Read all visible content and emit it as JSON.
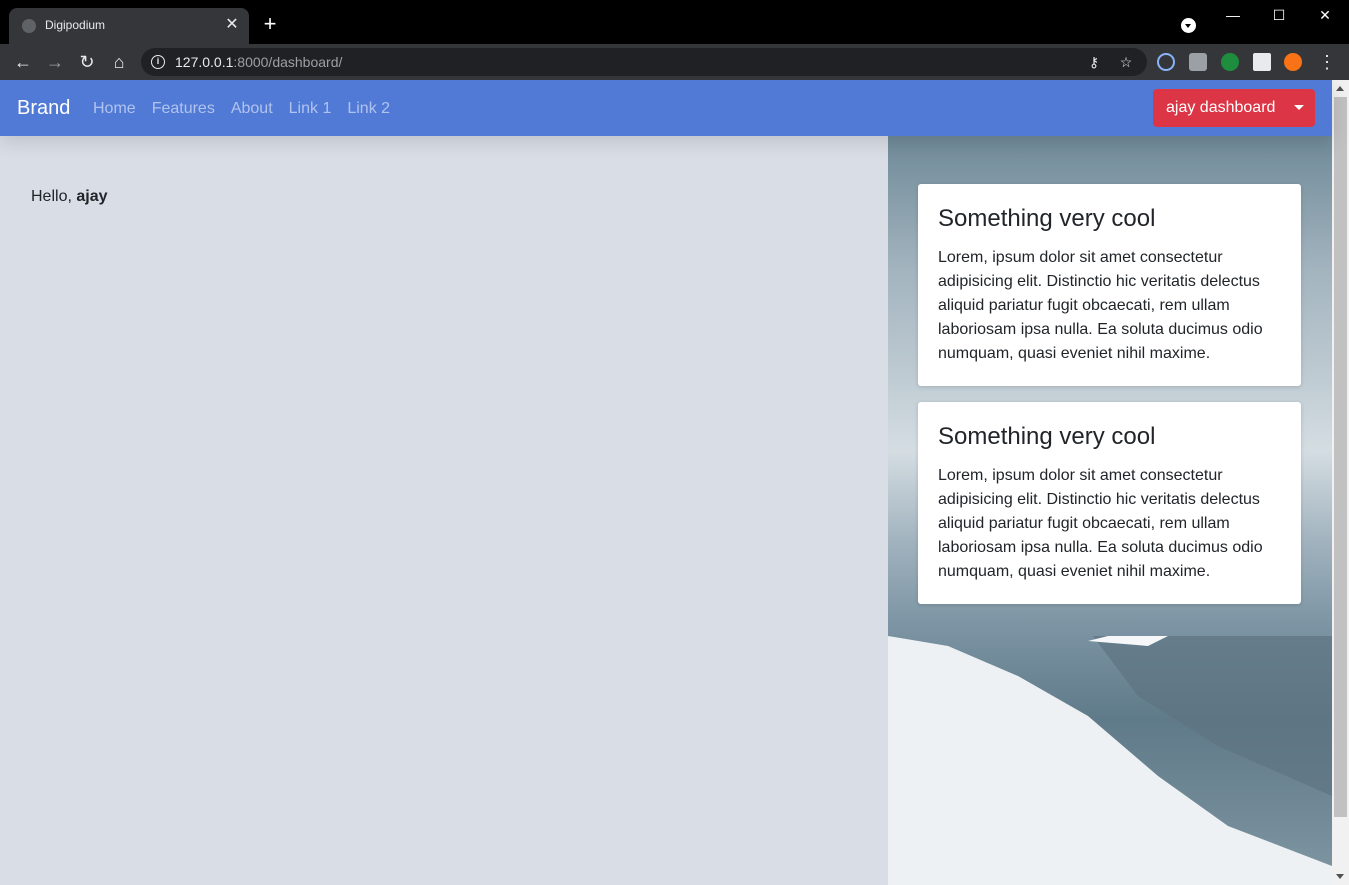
{
  "browser": {
    "tab_title": "Digipodium",
    "url_host": "127.0.0.1",
    "url_rest": ":8000/dashboard/"
  },
  "navbar": {
    "brand": "Brand",
    "links": [
      "Home",
      "Features",
      "About",
      "Link 1",
      "Link 2"
    ],
    "user_button": "ajay dashboard",
    "bg_color": "#517ad6",
    "button_color": "#dc3545"
  },
  "main": {
    "greeting": "Hello,",
    "username": "ajay"
  },
  "cards": [
    {
      "title": "Something very cool",
      "text": "Lorem, ipsum dolor sit amet consectetur adipisicing elit. Distinctio hic veritatis delectus aliquid pariatur fugit obcaecati, rem ullam laboriosam ipsa nulla. Ea soluta ducimus odio numquam, quasi eveniet nihil maxime."
    },
    {
      "title": "Something very cool",
      "text": "Lorem, ipsum dolor sit amet consectetur adipisicing elit. Distinctio hic veritatis delectus aliquid pariatur fugit obcaecati, rem ullam laboriosam ipsa nulla. Ea soluta ducimus odio numquam, quasi eveniet nihil maxime."
    }
  ]
}
